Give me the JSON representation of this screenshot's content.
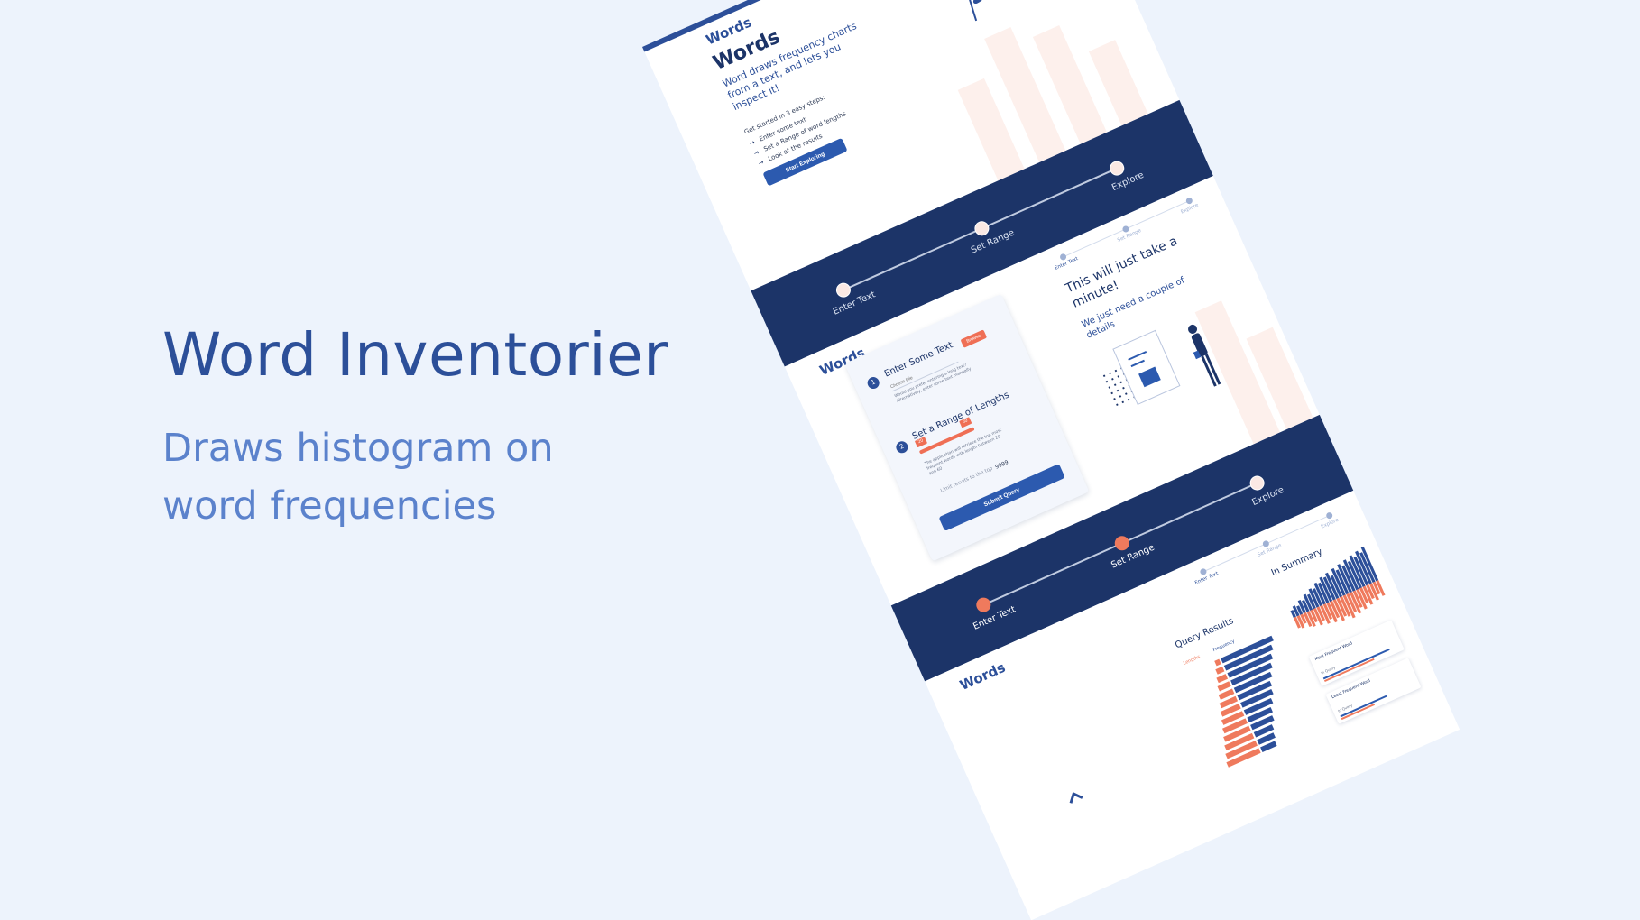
{
  "hero": {
    "title": "Word Inventorier",
    "subtitle": "Draws histogram on word frequencies"
  },
  "colors": {
    "primary": "#2c4f99",
    "navy": "#1c3468",
    "accent": "#ef7a5d",
    "page_bg": "#edf3fc"
  },
  "brand": {
    "logo": "Words"
  },
  "landing": {
    "heading": "Words",
    "intro": "Word draws frequency charts from a text, and lets you inspect it!",
    "steps_lead": "Get started in 3 easy steps:",
    "steps": [
      "Enter some text",
      "Set a Range of word lengths",
      "Look at the results"
    ],
    "cta": "Start Exploring"
  },
  "stepper": {
    "steps": [
      "Enter Text",
      "Set Range",
      "Explore"
    ]
  },
  "form": {
    "step1_num": "1",
    "step1_title": "Enter Some Text",
    "browse": "Browse",
    "file_placeholder": "Choose File",
    "step1_hint": "Would you prefer entering a long text? Alternatively, enter some text manually",
    "step2_num": "2",
    "step2_title": "Set a Range of Lengths",
    "range_low": "20",
    "range_high": "60",
    "step2_hint": "The application will retrieve the top most frequent words with length between 20 and 60",
    "limit_label": "Limit results to the top",
    "limit_value": "9999",
    "submit": "Submit Query"
  },
  "aside": {
    "title": "This will just take a minute!",
    "subtitle": "We just need a couple of details"
  },
  "results": {
    "query_title": "Query Results",
    "col_lengths": "Lengths",
    "col_frequency": "Frequency",
    "summary_title": "In Summary",
    "most_label": "Most Frequent Word",
    "least_label": "Least Frequent Word",
    "in_query": "In Query"
  },
  "chart_data": [
    {
      "type": "bar",
      "title": "Query Results",
      "series": [
        {
          "name": "Lengths",
          "values": [
            4,
            6,
            8,
            10,
            12,
            14,
            16,
            18,
            20,
            22,
            24,
            26,
            28
          ]
        },
        {
          "name": "Frequency",
          "values": [
            28,
            26,
            24,
            22,
            20,
            18,
            17,
            15,
            13,
            12,
            10,
            9,
            8
          ]
        }
      ]
    },
    {
      "type": "bar",
      "title": "In Summary",
      "series": [
        {
          "values": [
            10,
            14,
            12,
            18,
            16,
            22,
            20,
            26,
            24,
            30,
            28,
            34,
            32,
            36,
            30,
            38,
            34,
            40,
            36,
            42,
            38,
            44,
            40,
            46,
            42,
            48
          ]
        },
        {
          "values": [
            -14,
            -16,
            -12,
            -18,
            -20,
            -16,
            -22,
            -18,
            -24,
            -20,
            -26,
            -22,
            -28,
            -24,
            -26,
            -30,
            -24,
            -28,
            -22,
            -26,
            -20,
            -24,
            -18,
            -22,
            -16,
            -20
          ]
        }
      ]
    }
  ]
}
